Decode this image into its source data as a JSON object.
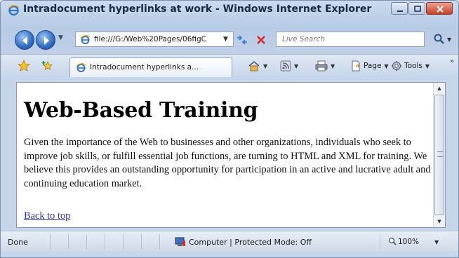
{
  "window": {
    "title": "Intradocument hyperlinks at work - Windows Internet Explorer"
  },
  "address_bar": {
    "url": "file:///G:/Web%20Pages/06figC",
    "search_placeholder": "Live Search"
  },
  "tab": {
    "label": "Intradocument hyperlinks a..."
  },
  "command_bar": {
    "page_label": "Page",
    "tools_label": "Tools"
  },
  "page": {
    "heading": "Web-Based Training",
    "paragraph": "Given the importance of the Web to businesses and other organizations, individuals who seek to improve job skills, or fulfill essential job functions, are turning to HTML and XML for training. We believe this provides an outstanding opportunity for participation in an active and lucrative adult and continuing education market.",
    "back_link": "Back to top"
  },
  "status_bar": {
    "status": "Done",
    "zone": "Computer | Protected Mode: Off",
    "zoom": "100%"
  },
  "colors": {
    "link": "#2a36b0",
    "close_button": "#c6402a"
  },
  "icons": [
    "ie-logo-icon",
    "back-arrow-icon",
    "forward-arrow-icon",
    "page-icon",
    "refresh-icon",
    "stop-icon",
    "search-icon",
    "favorites-star-icon",
    "add-favorites-icon",
    "home-icon",
    "feeds-icon",
    "print-icon",
    "page-menu-icon",
    "tools-gear-icon",
    "computer-zone-icon",
    "zoom-icon"
  ]
}
